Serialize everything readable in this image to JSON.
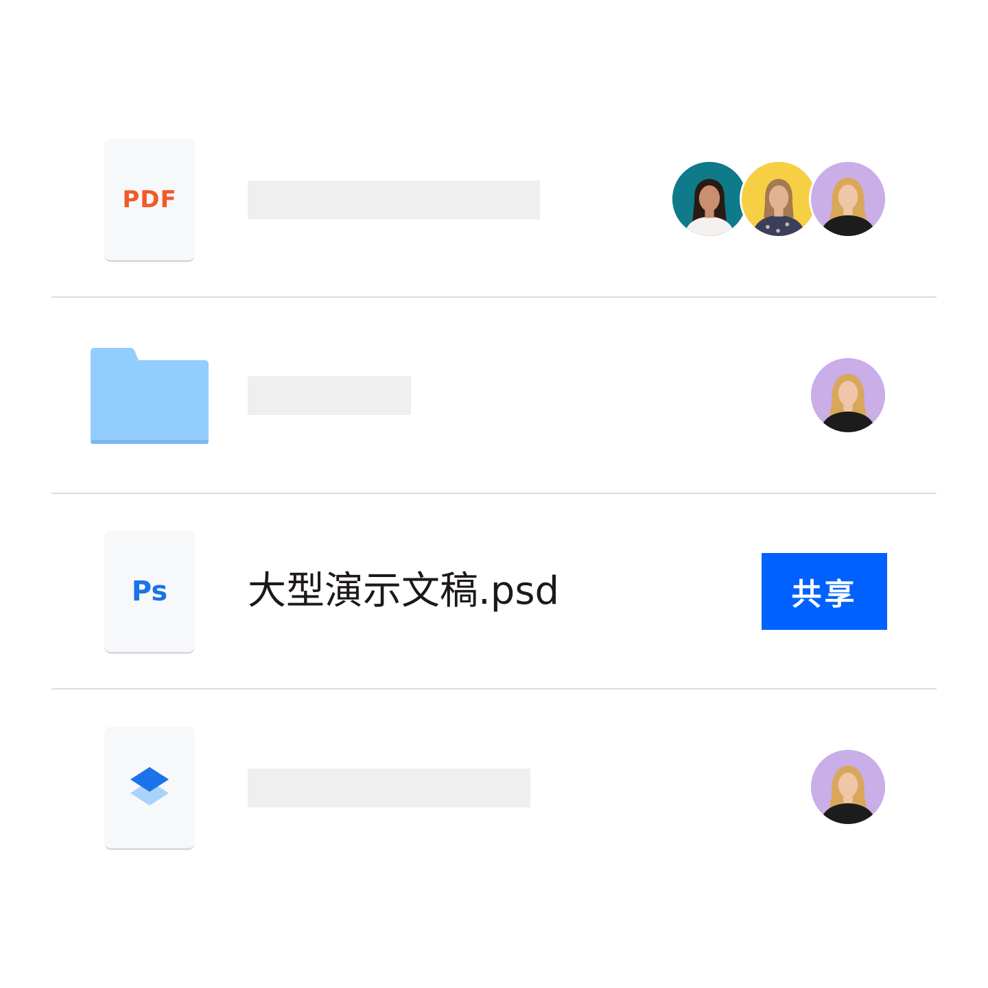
{
  "files": [
    {
      "type": "pdf",
      "icon": "pdf-file-icon",
      "badge_label": "PDF",
      "badge_color": "#f15a29",
      "name": "",
      "collaborators": [
        {
          "avatar": "avatar-teal",
          "bg": "#0e7a8a"
        },
        {
          "avatar": "avatar-yellow",
          "bg": "#f7cf45"
        },
        {
          "avatar": "avatar-lavender",
          "bg": "#c9aee8"
        }
      ]
    },
    {
      "type": "folder",
      "icon": "folder-icon",
      "folder_color": "#92cdfd",
      "name": "",
      "collaborators": [
        {
          "avatar": "avatar-lavender",
          "bg": "#c9aee8"
        }
      ]
    },
    {
      "type": "psd",
      "icon": "photoshop-file-icon",
      "badge_label": "Ps",
      "badge_color": "#1a73e8",
      "name": "大型演示文稿.psd",
      "action_label": "共享",
      "action_color": "#0061fe"
    },
    {
      "type": "dropbox-paper",
      "icon": "layers-file-icon",
      "name": "",
      "collaborators": [
        {
          "avatar": "avatar-lavender",
          "bg": "#c9aee8"
        }
      ]
    }
  ]
}
